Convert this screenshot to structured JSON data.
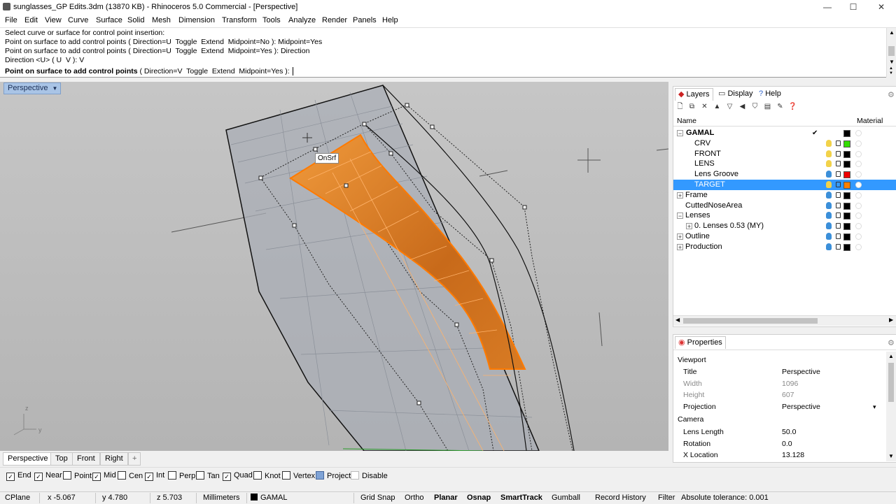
{
  "window": {
    "title": "sunglasses_GP Edits.3dm (13870 KB) - Rhinoceros 5.0 Commercial - [Perspective]",
    "controls": {
      "minimize": "—",
      "maximize": "☐",
      "close": "✕"
    }
  },
  "menu": [
    "File",
    "Edit",
    "View",
    "Curve",
    "Surface",
    "Solid",
    "Mesh",
    "Dimension",
    "Transform",
    "Tools",
    "Analyze",
    "Render",
    "Panels",
    "Help"
  ],
  "command": {
    "history": [
      "Select curve or surface for control point insertion:",
      "Point on surface to add control points ( Direction=U  Toggle  Extend  Midpoint=No ): Midpoint=Yes",
      "Point on surface to add control points ( Direction=U  Toggle  Extend  Midpoint=Yes ): Direction",
      "Direction <U> ( U  V ): V"
    ],
    "prompt_main": "Point on surface to add control points",
    "prompt_opts": " ( Direction=V  Toggle  Extend  Midpoint=Yes ): "
  },
  "viewport": {
    "title": "Perspective",
    "snap_tooltip": "OnSrf",
    "axis": {
      "z": "z",
      "y": "y"
    },
    "tabs": [
      "Perspective",
      "Top",
      "Front",
      "Right"
    ],
    "add_tab": "+"
  },
  "osnap": [
    {
      "label": "End",
      "checked": true
    },
    {
      "label": "Near",
      "checked": true
    },
    {
      "label": "Point",
      "checked": false
    },
    {
      "label": "Mid",
      "checked": true
    },
    {
      "label": "Cen",
      "checked": false
    },
    {
      "label": "Int",
      "checked": true
    },
    {
      "label": "Perp",
      "checked": false
    },
    {
      "label": "Tan",
      "checked": false
    },
    {
      "label": "Quad",
      "checked": true
    },
    {
      "label": "Knot",
      "checked": false
    },
    {
      "label": "Vertex",
      "checked": false
    },
    {
      "label": "Project",
      "checked": true
    },
    {
      "label": "Disable",
      "checked": false
    }
  ],
  "status": {
    "cplane": "CPlane",
    "x": "x -5.067",
    "y": "y 4.780",
    "z": "z 5.703",
    "units": "Millimeters",
    "layer": "GAMAL",
    "buttons": [
      "Grid Snap",
      "Ortho",
      "Planar",
      "Osnap",
      "SmartTrack",
      "Gumball",
      "Record History",
      "Filter"
    ],
    "tolerance": "Absolute tolerance: 0.001"
  },
  "layers_panel": {
    "tabs": [
      "Layers",
      "Display",
      "Help"
    ],
    "col_name": "Name",
    "col_material": "Material",
    "rows": [
      {
        "name": "GAMAL",
        "bold": true,
        "check": "✔",
        "color": "#000000"
      },
      {
        "name": "CRV",
        "color": "#33dd00"
      },
      {
        "name": "FRONT",
        "color": "#000000"
      },
      {
        "name": "LENS",
        "color": "#000000"
      },
      {
        "name": "Lens Groove",
        "color": "#ee0000"
      },
      {
        "name": "TARGET",
        "color": "#ff7f00",
        "selected": true
      },
      {
        "name": "Frame",
        "color": "#000000"
      },
      {
        "name": "CuttedNoseArea",
        "color": "#000000"
      },
      {
        "name": "Lenses",
        "color": "#000000"
      },
      {
        "name": "0. Lenses 0.53 (MY)",
        "color": "#000000"
      },
      {
        "name": "Outline",
        "color": "#000000"
      },
      {
        "name": "Production",
        "color": "#000000"
      }
    ]
  },
  "properties": {
    "tab": "Properties",
    "section_viewport": "Viewport",
    "section_camera": "Camera",
    "rows": [
      {
        "key": "Title",
        "value": "Perspective"
      },
      {
        "key": "Width",
        "value": "1096",
        "grey": true
      },
      {
        "key": "Height",
        "value": "607",
        "grey": true
      },
      {
        "key": "Projection",
        "value": "Perspective"
      },
      {
        "key": "Lens Length",
        "value": "50.0"
      },
      {
        "key": "Rotation",
        "value": "0.0"
      },
      {
        "key": "X Location",
        "value": "13.128"
      }
    ]
  }
}
